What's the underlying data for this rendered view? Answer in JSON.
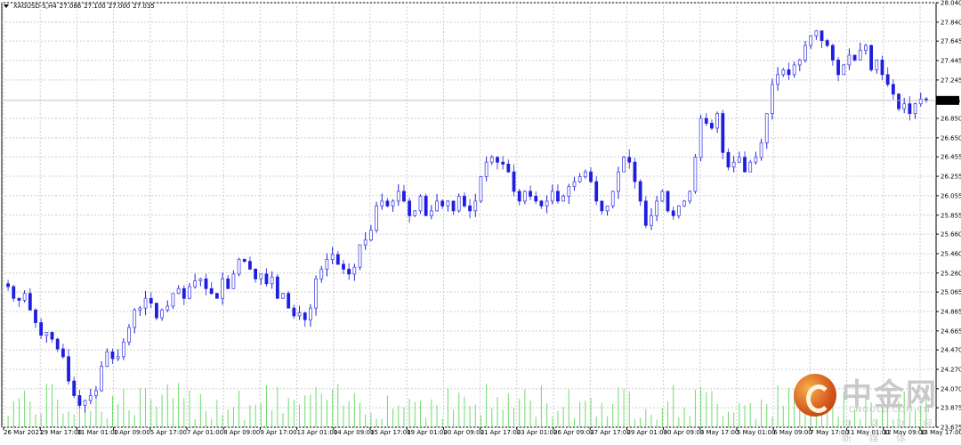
{
  "header": {
    "symbol": "XAGUSD-S,H4",
    "open": "27.086",
    "high": "27.100",
    "low": "27.000",
    "close": "27.035"
  },
  "watermark": {
    "cn": "中金网",
    "en": "CNGOLD.COM.CN",
    "sub": "中 文 财 经 新 媒 体"
  },
  "colors": {
    "bull": "#1e1ee0",
    "bear_body": "#ffffff",
    "bear_outline": "#4a4ae6",
    "volume": "#6fdc6f",
    "grid": "#cccccc",
    "price_tag_bg": "#000000",
    "price_tag_fg": "#ffffff"
  },
  "chart_data": {
    "type": "candlestick",
    "current_price": 27.035,
    "y_ticks": [
      "28.040",
      "27.840",
      "27.645",
      "27.445",
      "27.245",
      "26.850",
      "26.650",
      "26.455",
      "26.255",
      "26.055",
      "25.855",
      "25.660",
      "25.460",
      "25.260",
      "25.065",
      "24.865",
      "24.665",
      "24.470",
      "24.270",
      "24.070",
      "23.875",
      "23.675"
    ],
    "ylim": [
      23.675,
      28.04
    ],
    "x_ticks": [
      "26 Mar 2021",
      "29 Mar 17:00",
      "31 Mar 01:00",
      "1 Apr 09:00",
      "5 Apr 17:00",
      "7 Apr 01:00",
      "8 Apr 09:00",
      "9 Apr 17:00",
      "13 Apr 01:00",
      "14 Apr 09:00",
      "15 Apr 17:00",
      "19 Apr 01:00",
      "20 Apr 09:00",
      "21 Apr 17:00",
      "23 Apr 01:00",
      "26 Apr 09:00",
      "27 Apr 17:00",
      "29 Apr 01:00",
      "30 Apr 09:00",
      "3 May 17:00",
      "5 May 01:00",
      "6 May 09:00",
      "7 May 17:00",
      "11 May 01:00",
      "12 May 09:00",
      "13 May 17:00"
    ],
    "candles_close": [
      25.12,
      25.0,
      24.98,
      25.05,
      24.88,
      24.75,
      24.62,
      24.65,
      24.58,
      24.48,
      24.4,
      24.15,
      24.0,
      23.9,
      23.95,
      24.0,
      24.05,
      24.3,
      24.45,
      24.38,
      24.4,
      24.55,
      24.7,
      24.88,
      24.9,
      25.0,
      24.95,
      24.8,
      24.88,
      24.92,
      25.05,
      25.1,
      25.0,
      25.12,
      25.18,
      25.2,
      25.1,
      25.05,
      25.0,
      25.2,
      25.1,
      25.25,
      25.4,
      25.38,
      25.3,
      25.2,
      25.25,
      25.15,
      25.22,
      25.0,
      25.05,
      24.9,
      24.82,
      24.85,
      24.78,
      24.9,
      25.2,
      25.3,
      25.4,
      25.45,
      25.35,
      25.3,
      25.25,
      25.32,
      25.55,
      25.6,
      25.7,
      25.95,
      26.0,
      25.95,
      26.0,
      26.1,
      26.0,
      25.85,
      25.9,
      26.05,
      25.85,
      25.9,
      26.0,
      25.95,
      26.0,
      25.9,
      26.05,
      25.95,
      25.9,
      26.0,
      26.25,
      26.4,
      26.45,
      26.4,
      26.38,
      26.3,
      26.1,
      26.0,
      26.1,
      26.05,
      26.0,
      25.95,
      26.0,
      26.1,
      26.0,
      26.05,
      26.15,
      26.2,
      26.25,
      26.3,
      26.2,
      26.0,
      25.9,
      25.95,
      26.1,
      26.3,
      26.45,
      26.4,
      26.2,
      26.0,
      25.75,
      25.85,
      26.0,
      26.1,
      25.9,
      25.85,
      25.95,
      26.0,
      26.1,
      26.45,
      26.85,
      26.8,
      26.75,
      26.9,
      26.5,
      26.35,
      26.4,
      26.45,
      26.3,
      26.4,
      26.45,
      26.6,
      26.9,
      27.2,
      27.3,
      27.35,
      27.3,
      27.4,
      27.45,
      27.6,
      27.7,
      27.75,
      27.65,
      27.6,
      27.45,
      27.3,
      27.4,
      27.5,
      27.45,
      27.55,
      27.6,
      27.35,
      27.45,
      27.3,
      27.2,
      27.1,
      26.95,
      27.0,
      26.9,
      27.0,
      27.05,
      27.035
    ]
  }
}
